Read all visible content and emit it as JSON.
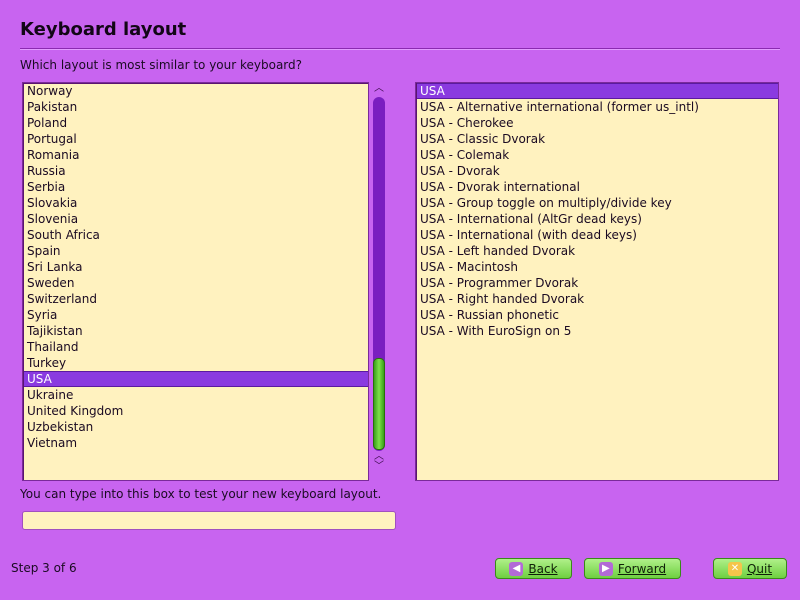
{
  "page": {
    "title": "Keyboard layout",
    "question": "Which layout is most similar to your keyboard?",
    "hint": "You can type into this box to test your new keyboard layout.",
    "test_input_value": "",
    "step": "Step 3 of 6"
  },
  "countries": {
    "selected": "USA",
    "items": [
      "Norway",
      "Pakistan",
      "Poland",
      "Portugal",
      "Romania",
      "Russia",
      "Serbia",
      "Slovakia",
      "Slovenia",
      "South Africa",
      "Spain",
      "Sri Lanka",
      "Sweden",
      "Switzerland",
      "Syria",
      "Tajikistan",
      "Thailand",
      "Turkey",
      "USA",
      "Ukraine",
      "United Kingdom",
      "Uzbekistan",
      "Vietnam"
    ]
  },
  "variants": {
    "selected": "USA",
    "items": [
      "USA",
      "USA - Alternative international (former us_intl)",
      "USA - Cherokee",
      "USA - Classic Dvorak",
      "USA - Colemak",
      "USA - Dvorak",
      "USA - Dvorak international",
      "USA - Group toggle on multiply/divide key",
      "USA - International (AltGr dead keys)",
      "USA - International (with dead keys)",
      "USA - Left handed Dvorak",
      "USA - Macintosh",
      "USA - Programmer Dvorak",
      "USA - Right handed Dvorak",
      "USA - Russian phonetic",
      "USA - With EuroSign on 5"
    ]
  },
  "buttons": {
    "back": "Back",
    "forward": "Forward",
    "quit": "Quit"
  },
  "icons": {
    "back": "arrow-left-icon",
    "forward": "arrow-right-icon",
    "quit": "quit-icon",
    "scroll_up": "chevron-up-icon",
    "scroll_down": "chevron-down-icon"
  },
  "colors": {
    "background": "#c864f0",
    "list_background": "#fff2bf",
    "selection": "#8a3ae0",
    "button": "#8ee060"
  }
}
